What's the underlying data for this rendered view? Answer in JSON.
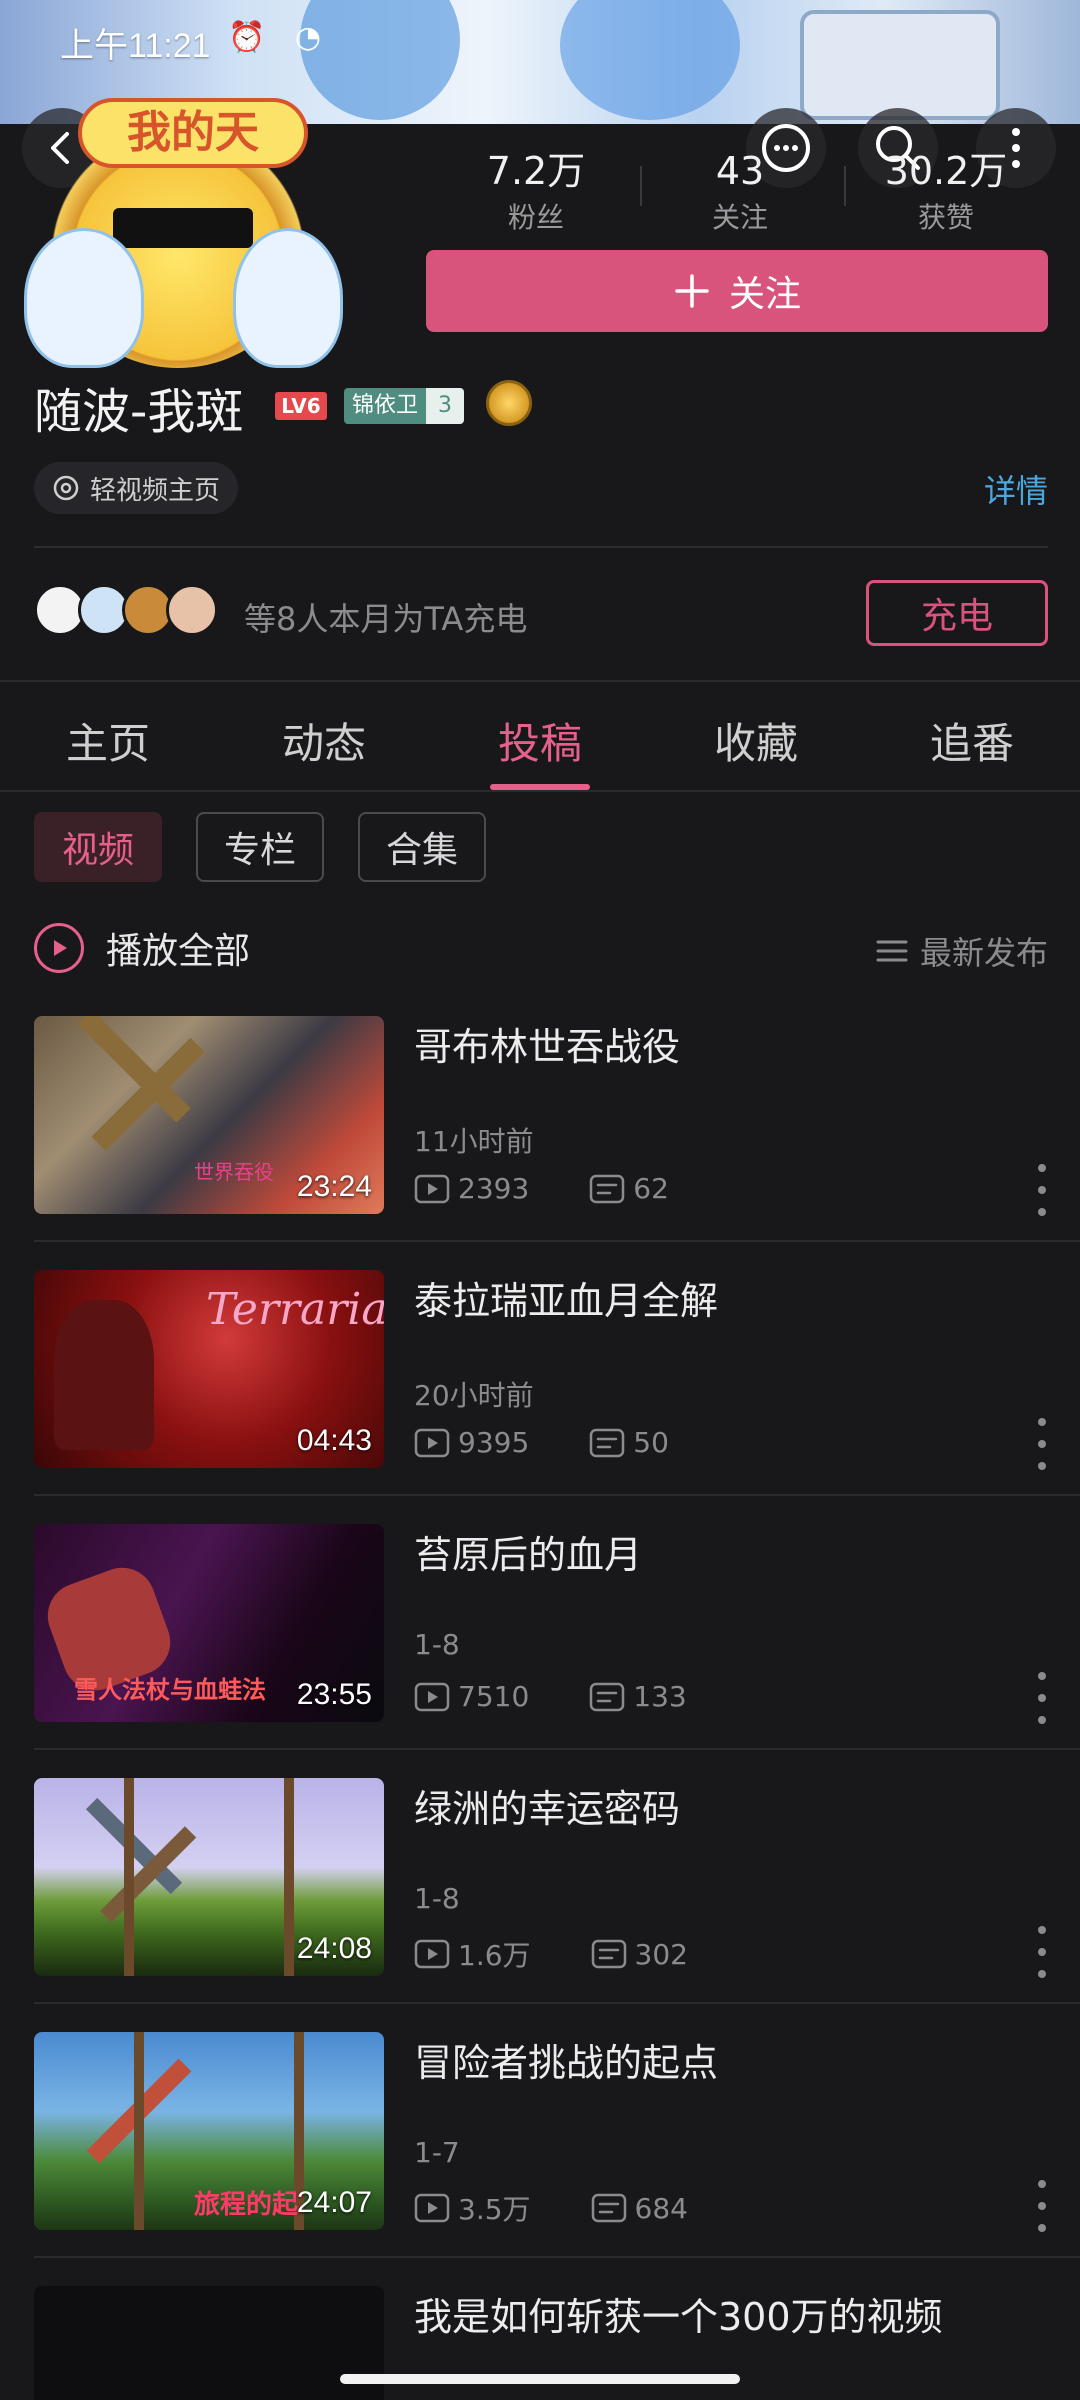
{
  "status_bar": {
    "time": "上午11:21"
  },
  "stats": [
    {
      "value": "7.2万",
      "label": "粉丝"
    },
    {
      "value": "43",
      "label": "关注"
    },
    {
      "value": "30.2万",
      "label": "获赞"
    }
  ],
  "profile": {
    "follow_label": "关注",
    "follow_icon": "plus-icon",
    "username": "随波-我斑",
    "level": "LV6",
    "fan_badge_name": "锦依卫",
    "fan_badge_level": "3",
    "avatar_banner_text": "我的天",
    "video_home_label": "轻视频主页",
    "detail_label": "详情"
  },
  "charge": {
    "text": "等8人本月为TA充电",
    "button_label": "充电"
  },
  "tabs": [
    {
      "label": "主页"
    },
    {
      "label": "动态"
    },
    {
      "label": "投稿",
      "active": true
    },
    {
      "label": "收藏"
    },
    {
      "label": "追番"
    }
  ],
  "chips": [
    {
      "label": "视频",
      "active": true
    },
    {
      "label": "专栏"
    },
    {
      "label": "合集"
    }
  ],
  "toolbar": {
    "play_all_label": "播放全部",
    "sort_label": "最新发布"
  },
  "videos": [
    {
      "title": "哥布林世吞战役",
      "time": "11小时前",
      "views": "2393",
      "comments": "62",
      "duration": "23:24",
      "thumb_text": "世界吞役"
    },
    {
      "title": "泰拉瑞亚血月全解",
      "time": "20小时前",
      "views": "9395",
      "comments": "50",
      "duration": "04:43",
      "thumb_text": "Terraria"
    },
    {
      "title": "苔原后的血月",
      "time": "1-8",
      "views": "7510",
      "comments": "133",
      "duration": "23:55",
      "thumb_text": "雪人法杖与血蛙法"
    },
    {
      "title": "绿洲的幸运密码",
      "time": "1-8",
      "views": "1.6万",
      "comments": "302",
      "duration": "24:08",
      "thumb_text": ""
    },
    {
      "title": "冒险者挑战的起点",
      "time": "1-7",
      "views": "3.5万",
      "comments": "684",
      "duration": "24:07",
      "thumb_text": "旅程的起"
    },
    {
      "title": "我是如何斩获一个300万的视频",
      "time": "",
      "views": "",
      "comments": "",
      "duration": "",
      "thumb_text": ""
    }
  ],
  "colors": {
    "accent": "#d9547d",
    "accent_text": "#e5608a",
    "link": "#4aa8e0",
    "background": "#18181b"
  }
}
